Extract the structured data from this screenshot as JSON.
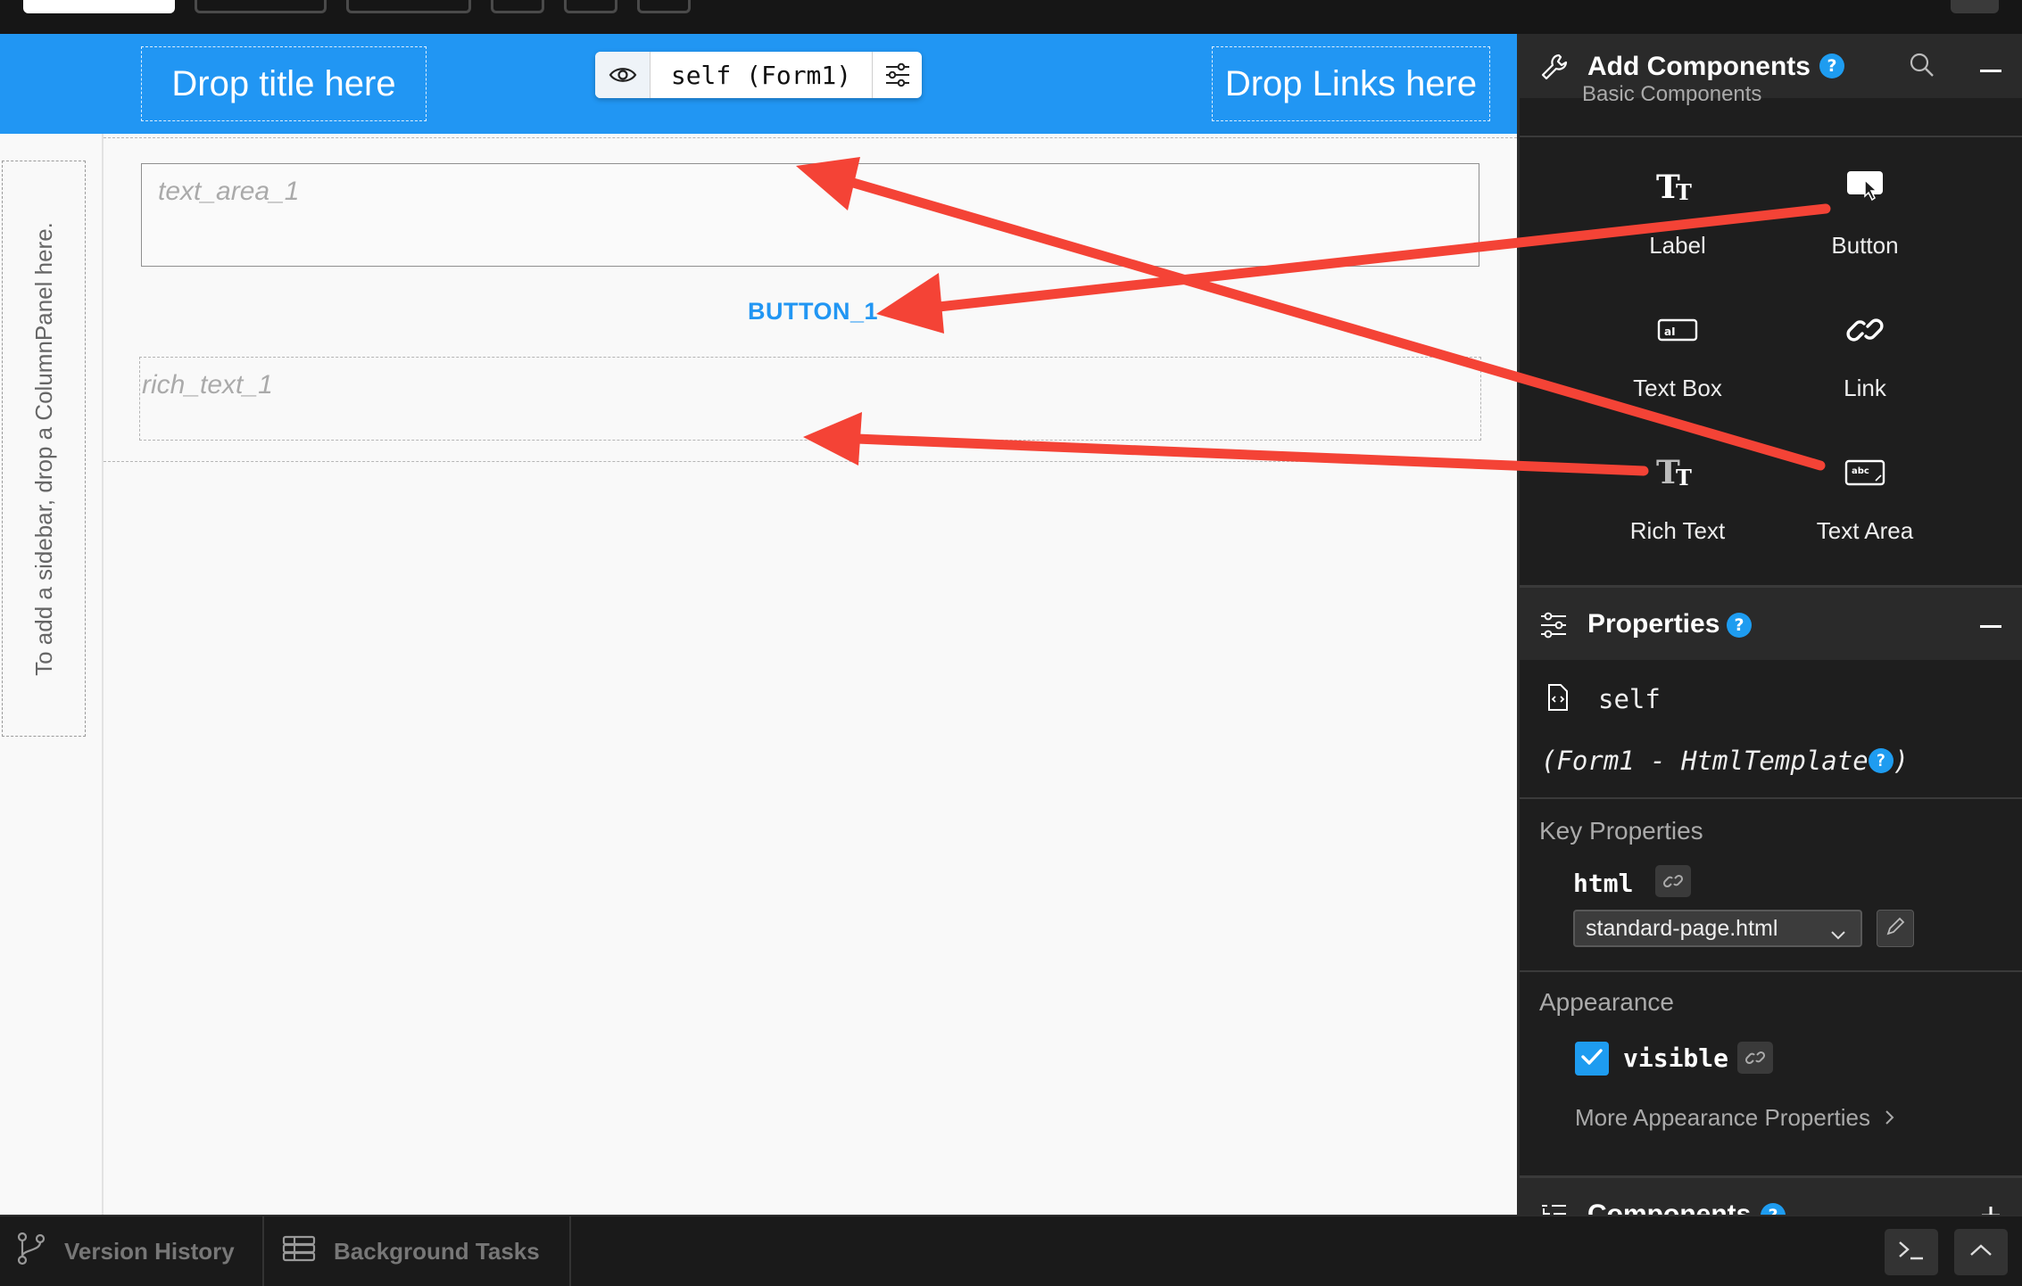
{
  "canvas": {
    "drop_title": "Drop title here",
    "drop_links": "Drop Links here",
    "form_pill": "self (Form1)",
    "sidebar_hint": "To add a sidebar, drop a ColumnPanel here.",
    "text_area_placeholder": "text_area_1",
    "button_text": "BUTTON_1",
    "rich_text_placeholder": "rich_text_1"
  },
  "add_components": {
    "title": "Add Components",
    "help": "?",
    "sub_heading": "Basic Components",
    "items": [
      {
        "label": "Label",
        "icon": "label-icon"
      },
      {
        "label": "Button",
        "icon": "button-icon"
      },
      {
        "label": "Text Box",
        "icon": "textbox-icon"
      },
      {
        "label": "Link",
        "icon": "link-icon"
      },
      {
        "label": "Rich Text",
        "icon": "richtext-icon"
      },
      {
        "label": "Text Area",
        "icon": "textarea-icon"
      }
    ]
  },
  "properties": {
    "title": "Properties",
    "help": "?",
    "self_label": "self",
    "form_desc_prefix": "(Form1 - HtmlTemplate",
    "form_desc_suffix": ")",
    "key_properties_label": "Key Properties",
    "html_prop": "html",
    "html_value": "standard-page.html",
    "appearance_label": "Appearance",
    "visible_prop": "visible",
    "visible_checked": true,
    "more_appearance": "More Appearance Properties"
  },
  "components_section": {
    "title": "Components",
    "help": "?"
  },
  "bottom_bar": {
    "version_history": "Version History",
    "background_tasks": "Background Tasks"
  },
  "colors": {
    "header_blue": "#2196f3",
    "accent": "#1e9cf0",
    "arrow_red": "#f44336"
  }
}
